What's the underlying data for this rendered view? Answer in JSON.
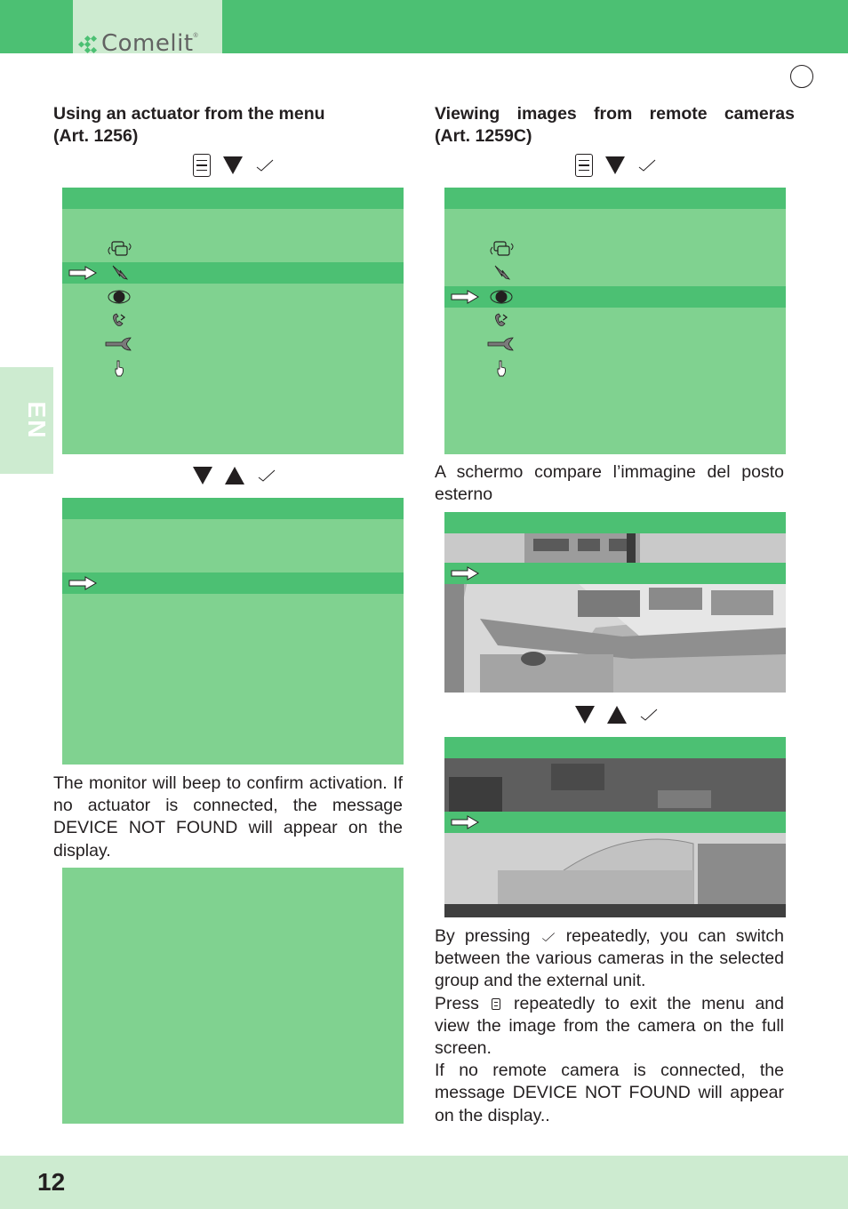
{
  "header": {
    "brand": "Comelit",
    "registered": "®",
    "colors": {
      "primary_green": "#4cc073",
      "light_green": "#cdebd0",
      "screen_green": "#80d290",
      "text": "#231f20"
    }
  },
  "sidebar": {
    "language_tab": "EN"
  },
  "footer": {
    "page_number": "12"
  },
  "left_column": {
    "heading_line1": "Using an actuator from the menu",
    "heading_line2": "(Art. 1256)",
    "step1_keys": [
      "menu-key",
      "down-key",
      "ok-key"
    ],
    "menu_screen": {
      "items": [
        {
          "icon": "swap-screens-icon",
          "selected": false
        },
        {
          "icon": "actuator-lightning-icon",
          "selected": true
        },
        {
          "icon": "eye-icon",
          "selected": false
        },
        {
          "icon": "intercom-call-icon",
          "selected": false
        },
        {
          "icon": "wrench-icon",
          "selected": false
        },
        {
          "icon": "hand-pointer-icon",
          "selected": false
        }
      ]
    },
    "step2_keys": [
      "down-key",
      "up-key",
      "ok-key"
    ],
    "actuator_screen": {
      "selected_row": 2
    },
    "paragraph": "The monitor will beep to confirm activation. If no actuator is connected, the message DEVICE NOT FOUND will appear on the display."
  },
  "right_column": {
    "heading_line1": "Viewing images from remote cameras",
    "heading_line2": "(Art. 1259C)",
    "step1_keys": [
      "menu-key",
      "down-key",
      "ok-key"
    ],
    "menu_screen": {
      "items": [
        {
          "icon": "swap-screens-icon",
          "selected": false
        },
        {
          "icon": "actuator-lightning-icon",
          "selected": false
        },
        {
          "icon": "eye-icon",
          "selected": true
        },
        {
          "icon": "intercom-call-icon",
          "selected": false
        },
        {
          "icon": "wrench-icon",
          "selected": false
        },
        {
          "icon": "hand-pointer-icon",
          "selected": false
        }
      ]
    },
    "caption": "A schermo compare l’immagine del posto esterno",
    "camera_image_1": "Parking lot camera view",
    "step2_keys": [
      "down-key",
      "up-key",
      "ok-key"
    ],
    "camera_image_2": "Tent structure camera view",
    "paragraph1_before": "By pressing",
    "paragraph1_after": "repeatedly, you can switch between the various cameras in the selected group and the external unit.",
    "paragraph2_before": "Press",
    "paragraph2_after": "repeatedly to exit the menu and view the image from the camera on the full screen.",
    "paragraph3": "If no remote camera is connected, the message DEVICE NOT FOUND will appear on the display.."
  }
}
